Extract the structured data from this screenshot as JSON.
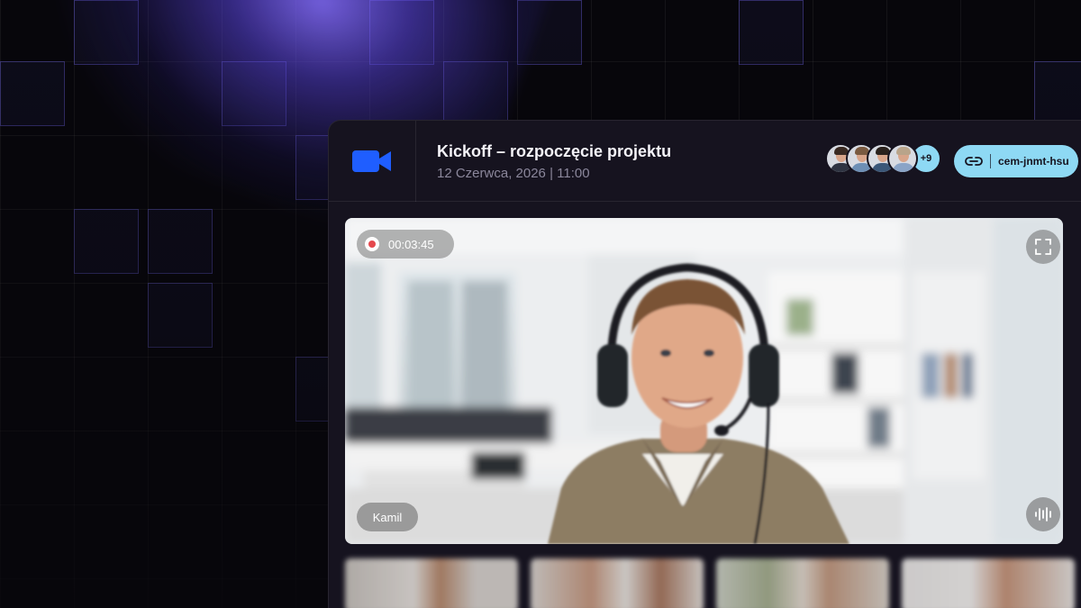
{
  "meeting": {
    "title": "Kickoff – rozpoczęcie projektu",
    "datetime": "12 Czerwca, 2026 | 11:00"
  },
  "participants": {
    "avatars": [
      {
        "name": "participant-1",
        "hair": "#3a2a22",
        "shirt": "#2f3442"
      },
      {
        "name": "participant-2",
        "hair": "#7a5a40",
        "shirt": "#6d8fb5"
      },
      {
        "name": "participant-3",
        "hair": "#2a211c",
        "shirt": "#3b5778"
      },
      {
        "name": "participant-4",
        "hair": "#b9a48a",
        "shirt": "#8aa4c7"
      }
    ],
    "more_count": "+9"
  },
  "meeting_link": {
    "code": "cem-jnmt-hsu",
    "icon": "link-icon"
  },
  "main_video": {
    "recording_time": "00:03:45",
    "speaker_name": "Kamil"
  },
  "colors": {
    "accent_blue": "#1f5eff",
    "link_pill": "#8ed9f4",
    "recording_red": "#e5484d",
    "window_bg": "#16131f"
  }
}
